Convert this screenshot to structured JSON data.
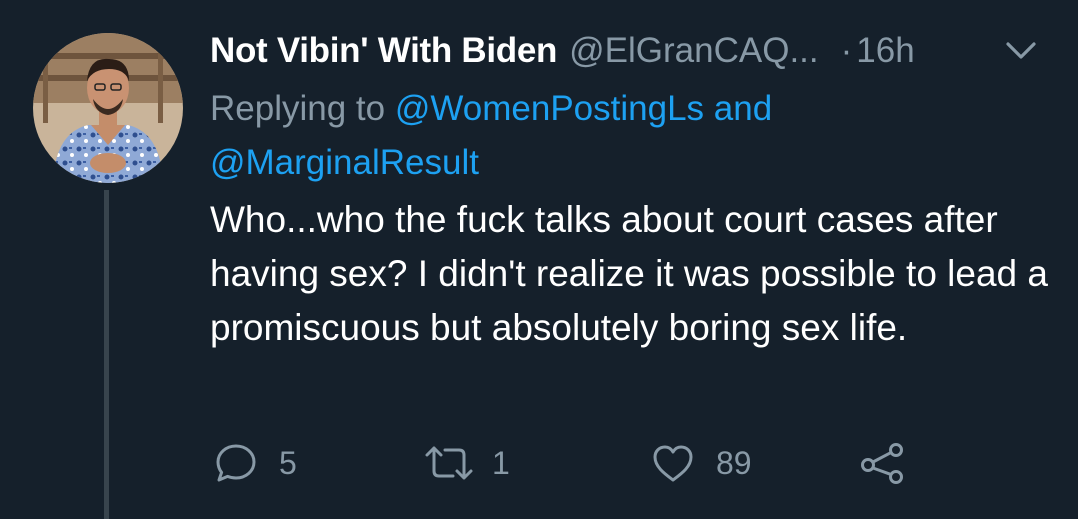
{
  "tweet": {
    "display_name": "Not Vibin' With Biden",
    "handle": "@ElGranCAQ...",
    "dot": "·",
    "time": "16h",
    "replying_prefix": "Replying to",
    "mention_1": "@WomenPostingLs",
    "replying_and": "and",
    "mention_2": "@MarginalResult",
    "text": "Who...who the fuck talks about court cases after having sex? I didn't realize it was possible to lead a promiscuous but absolutely boring sex life.",
    "reply_count": "5",
    "retweet_count": "1",
    "like_count": "89"
  },
  "icons": {
    "caret": "chevron-down-icon",
    "reply": "reply-icon",
    "retweet": "retweet-icon",
    "like": "heart-icon",
    "share": "share-icon"
  },
  "colors": {
    "background": "#15202b",
    "primary_text": "#ffffff",
    "secondary_text": "#8899a6",
    "link": "#1da1f2",
    "thread_line": "#38444d"
  }
}
